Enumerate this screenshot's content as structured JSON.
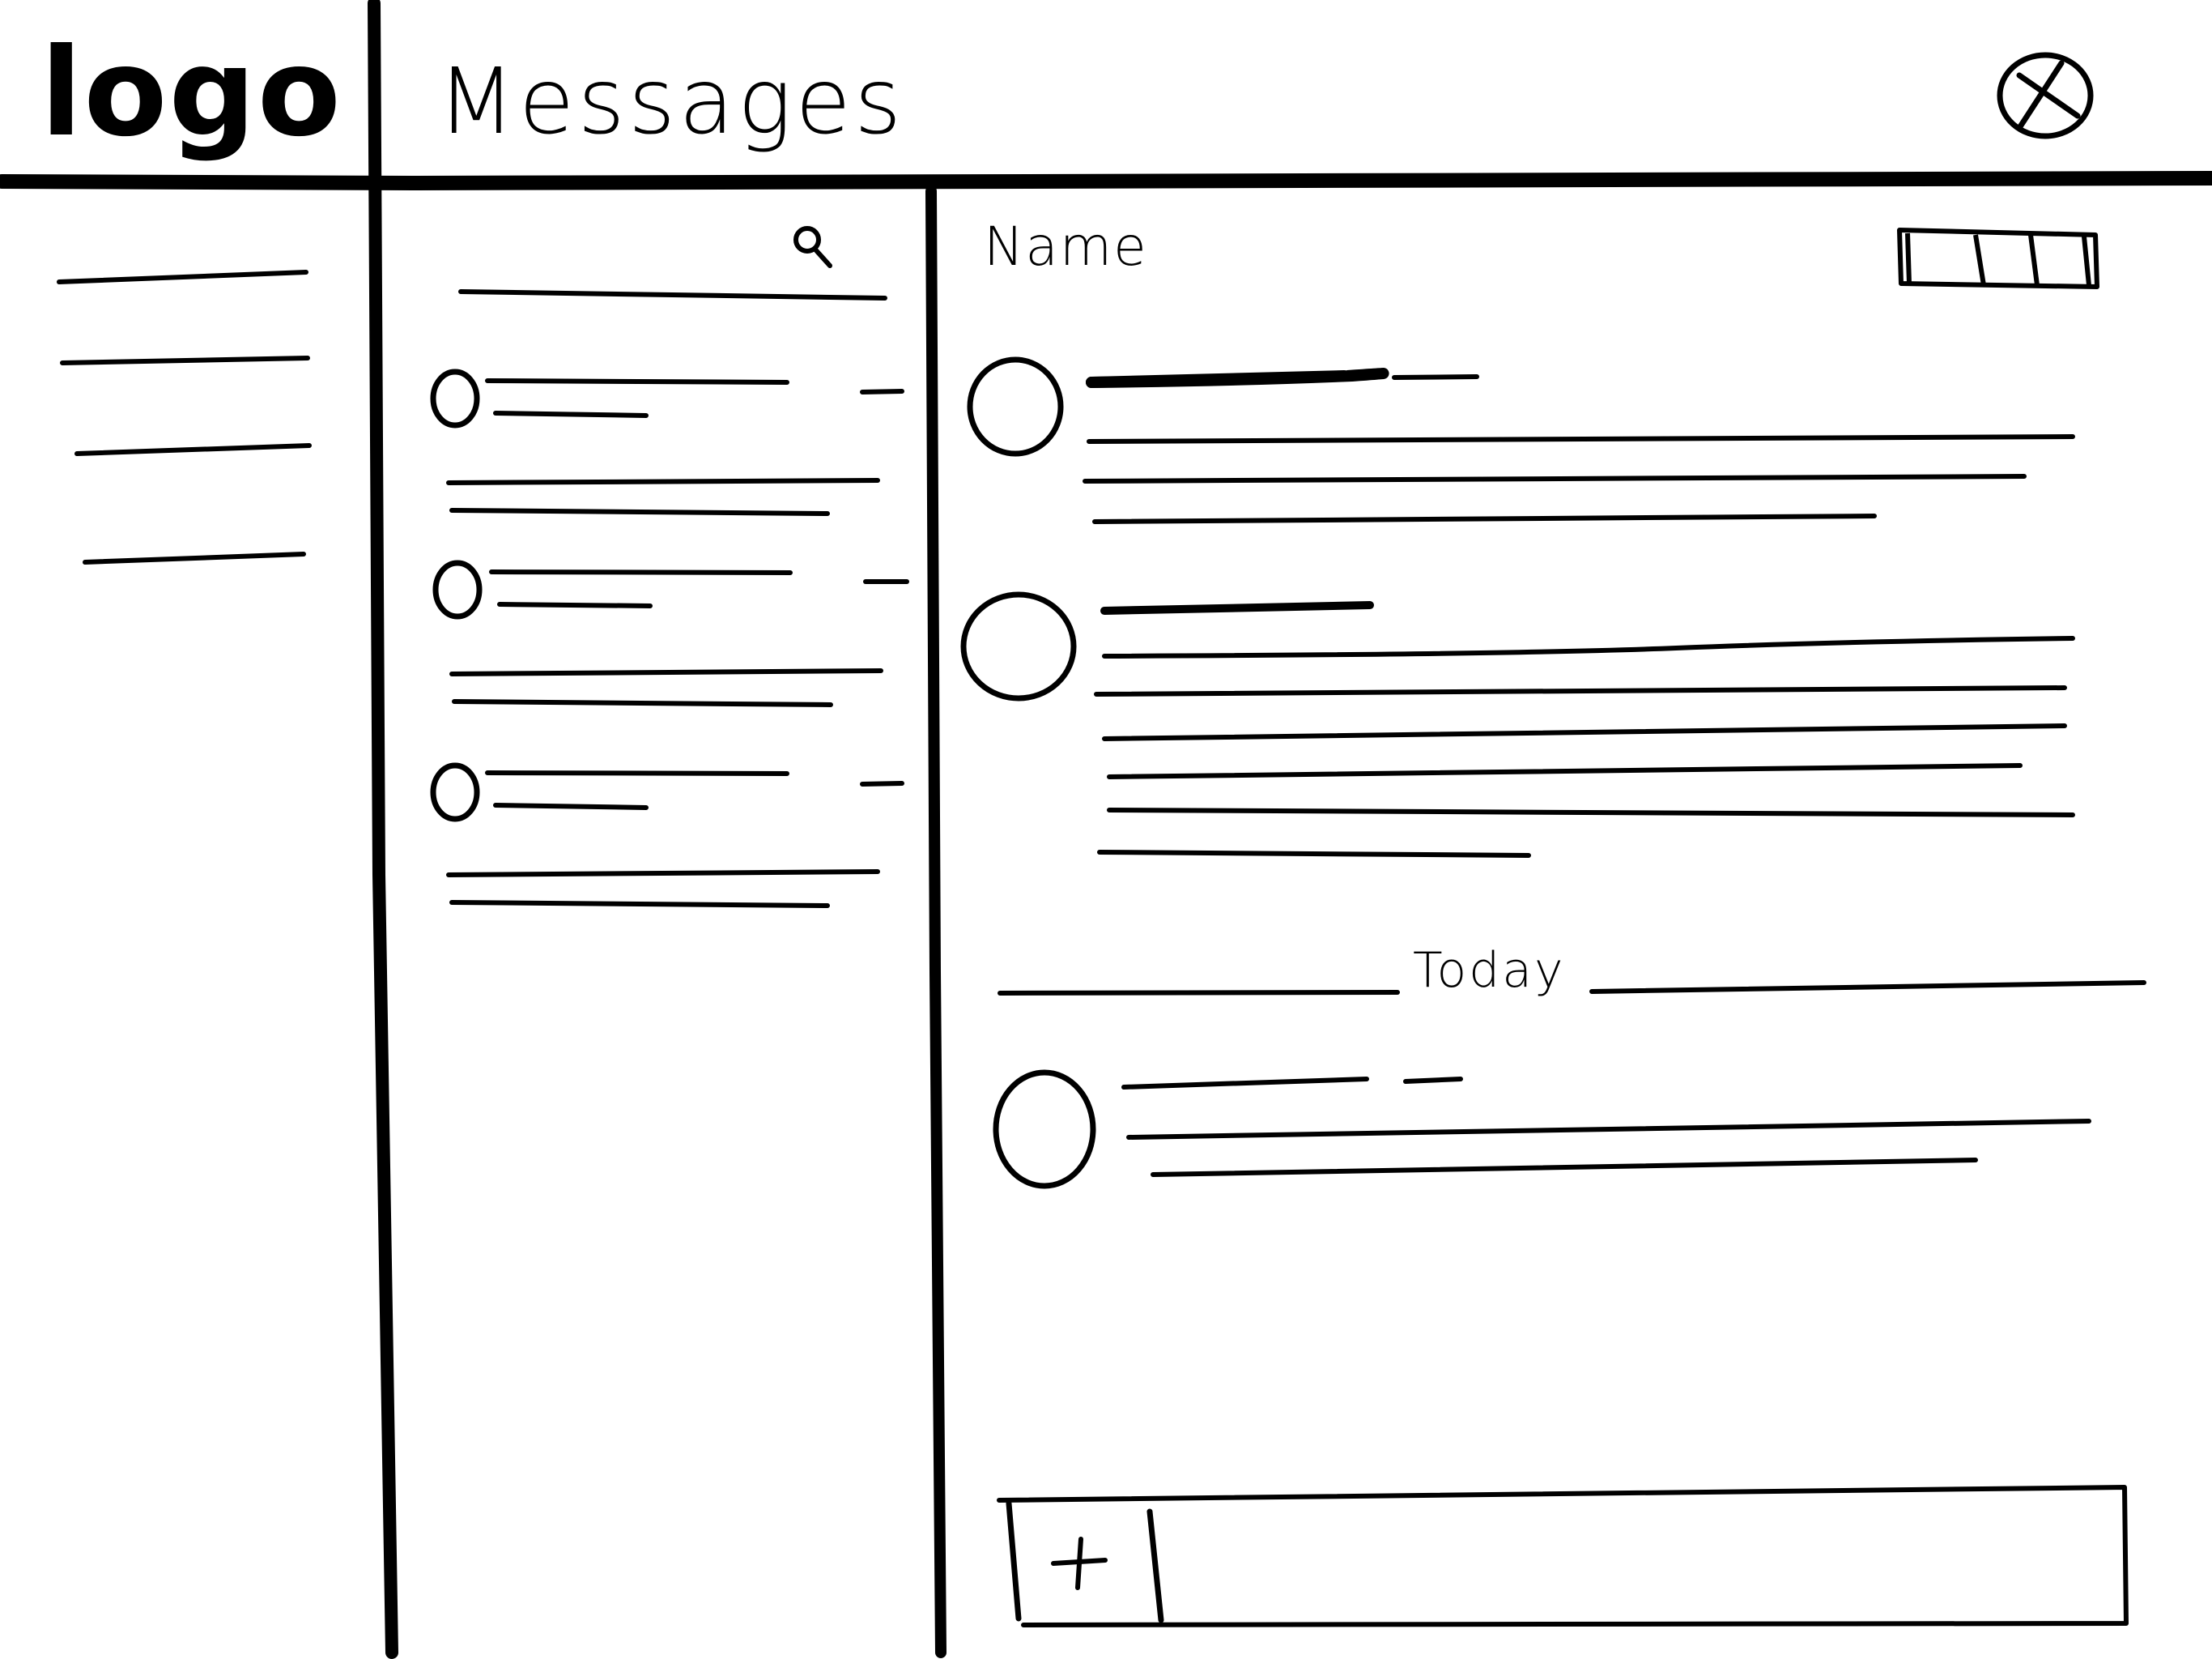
{
  "header": {
    "logo_text": "logo",
    "title": "Messages",
    "close_icon": "close-circle-icon"
  },
  "nav": {
    "items": [
      {
        "placeholder": "nav item"
      },
      {
        "placeholder": "nav item"
      },
      {
        "placeholder": "nav item"
      },
      {
        "placeholder": "nav item"
      }
    ]
  },
  "conversations": {
    "search_icon": "search-icon",
    "items": [
      {
        "avatar": "avatar"
      },
      {
        "avatar": "avatar"
      },
      {
        "avatar": "avatar"
      }
    ]
  },
  "chat": {
    "name": "Name",
    "toolbar_icon": "toolbar-icon",
    "divider_label": "Today",
    "messages": [
      {
        "avatar": "avatar"
      },
      {
        "avatar": "avatar"
      },
      {
        "avatar": "avatar"
      }
    ]
  },
  "composer": {
    "attach_icon": "plus-icon",
    "input_placeholder": ""
  }
}
